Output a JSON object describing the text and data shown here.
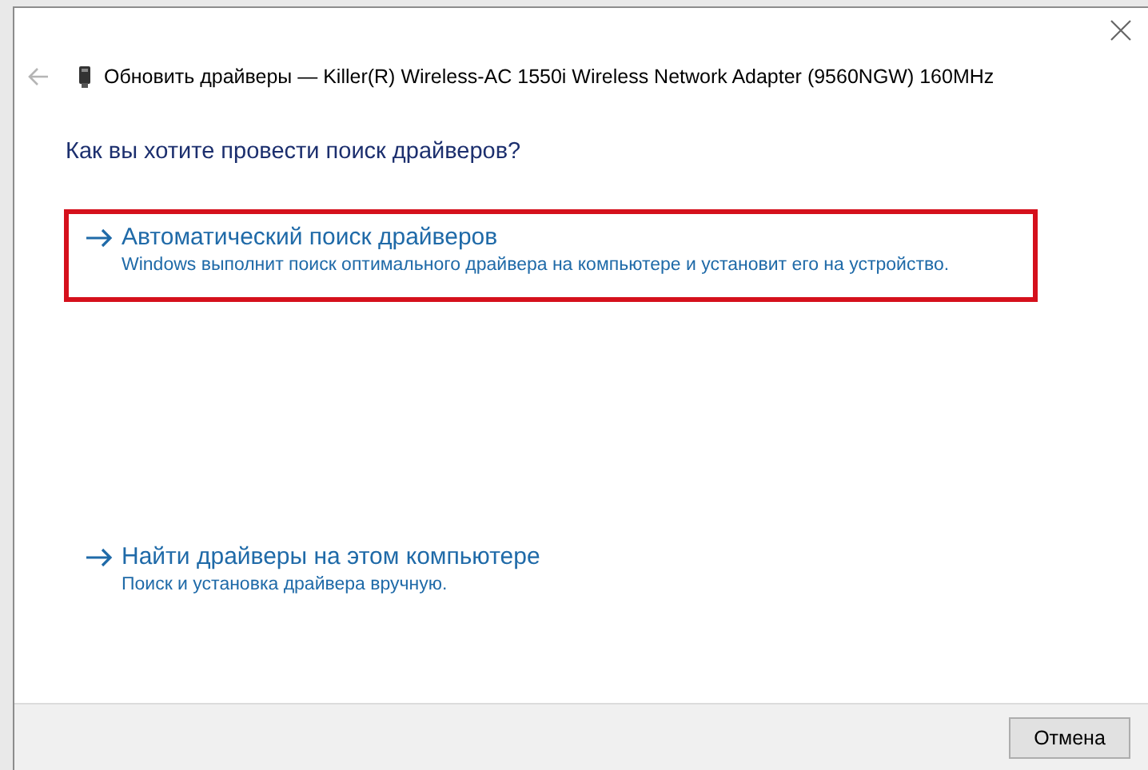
{
  "dialog": {
    "title": "Обновить драйверы — Killer(R) Wireless-AC 1550i Wireless Network Adapter (9560NGW) 160MHz",
    "heading": "Как вы хотите провести поиск драйверов?",
    "options": [
      {
        "title": "Автоматический поиск драйверов",
        "description": "Windows выполнит поиск оптимального драйвера на компьютере и установит его на устройство.",
        "highlighted": true
      },
      {
        "title": "Найти драйверы на этом компьютере",
        "description": "Поиск и установка драйвера вручную.",
        "highlighted": false
      }
    ],
    "buttons": [
      "Отмена"
    ]
  }
}
